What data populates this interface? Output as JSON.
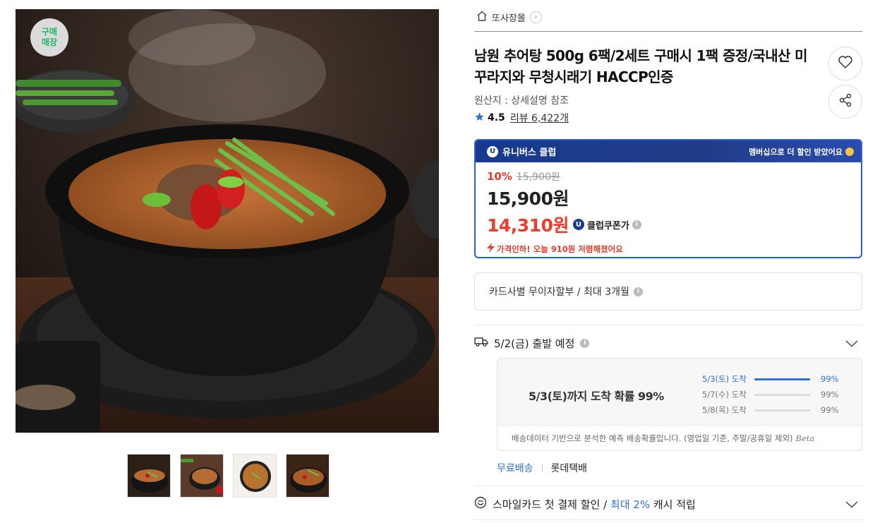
{
  "image": {
    "badge": "구매\n매장",
    "thumbnail_count": 4
  },
  "breadcrumb": {
    "store_name": "또사장몰"
  },
  "product": {
    "title": "남원 추어탕 500g 6팩/2세트 구매시 1팩 증정/국내산 미꾸라지와 무청시래기 HACCP인증",
    "origin": "원산지 : 상세설명 참조",
    "rating": "4.5",
    "review_label": "리뷰 6,422개"
  },
  "club": {
    "name": "유니버스 클럽",
    "logo_letter": "U",
    "promo": "멤버십으로 더 할인 받았어요",
    "discount_rate": "10%",
    "original_price": "15,900원",
    "price": "15,900원",
    "club_price": "14,310원",
    "club_coupon_label": "클럽쿠폰가",
    "price_drop": "가격인하! 오늘 910원 저렴해졌어요"
  },
  "installment": {
    "text": "카드사별 무이자할부 / 최대 3개월"
  },
  "shipping": {
    "departure": "5/2(금) 출발 예정",
    "headline": "5/3(토)까지 도착 확률 99%",
    "probabilities": [
      {
        "label": "5/3(토) 도착",
        "value": "99%",
        "fill": 0.99,
        "highlight": true
      },
      {
        "label": "5/7(수) 도착",
        "value": "99%",
        "fill": 0.0,
        "highlight": false
      },
      {
        "label": "5/8(목) 도착",
        "value": "99%",
        "fill": 0.0,
        "highlight": false
      }
    ],
    "footnote": "배송데이터 기반으로 분석한 예측 배송확률입니다. (영업일 기준, 주말/공휴일 제외)",
    "beta": "Beta",
    "free_shipping": "무료배송",
    "courier": "롯데택배"
  },
  "card_benefit": {
    "prefix": "스마일카드 첫 결제 할인 / ",
    "highlight": "최대 2%",
    "suffix": " 캐시 적립"
  },
  "colors": {
    "accent_blue": "#2f6fe0",
    "sale_red": "#f03a2a",
    "club_navy": "#173a8e",
    "badge_green": "#1cb86b"
  }
}
